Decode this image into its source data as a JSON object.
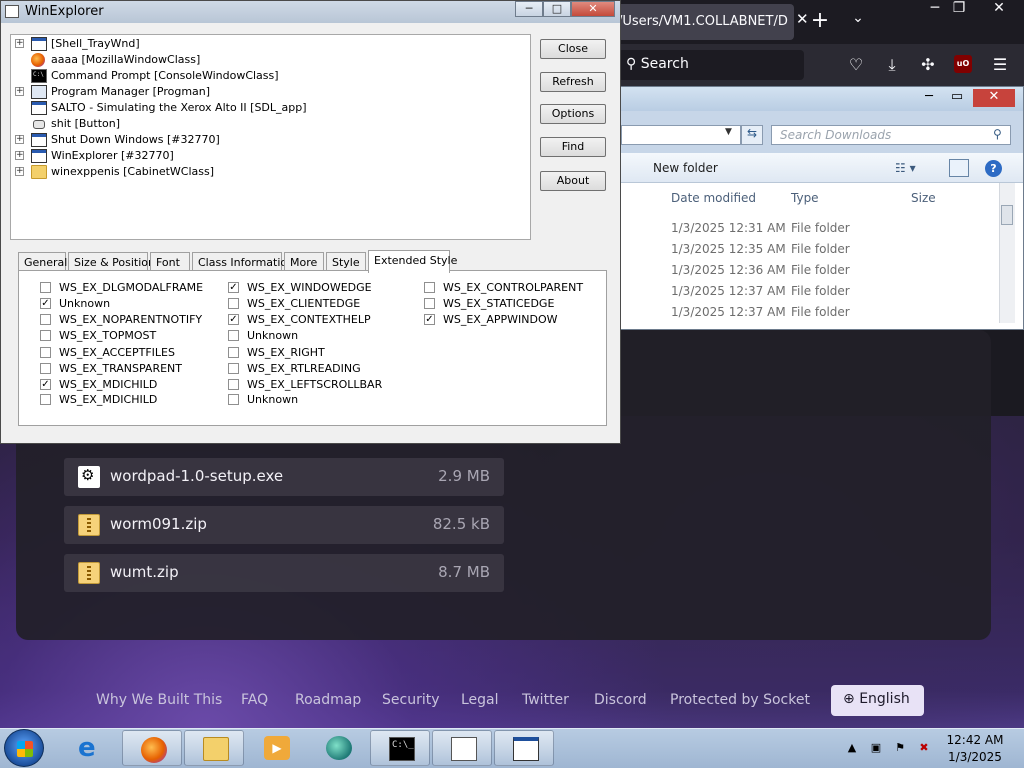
{
  "firefox": {
    "tab_title": "/Users/VM1.COLLABNET/D",
    "tab_close": "✕",
    "new_tab": "+",
    "tab_list": "❯",
    "search_placeholder": "Search",
    "ublock": "uO",
    "win_min": "─",
    "win_max": "❐",
    "win_close": "✕"
  },
  "downloads": {
    "items": [
      {
        "name": "wordpad-1.0-setup.exe",
        "size": "2.9 MB",
        "icon": "exe-icon"
      },
      {
        "name": "worm091.zip",
        "size": "82.5 kB",
        "icon": "zip-icon"
      },
      {
        "name": "wumt.zip",
        "size": "8.7 MB",
        "icon": "zip-icon"
      }
    ]
  },
  "footer": {
    "links": [
      "Why We Built This",
      "FAQ",
      "Roadmap",
      "Security",
      "Legal",
      "Twitter",
      "Discord",
      "Protected by Socket"
    ],
    "language": "English"
  },
  "explorer": {
    "search_placeholder": "Search Downloads",
    "new_folder": "New folder",
    "columns": {
      "date": "Date modified",
      "type": "Type",
      "size": "Size"
    },
    "rows": [
      {
        "date": "1/3/2025 12:31 AM",
        "type": "File folder"
      },
      {
        "date": "1/3/2025 12:35 AM",
        "type": "File folder"
      },
      {
        "date": "1/3/2025 12:36 AM",
        "type": "File folder"
      },
      {
        "date": "1/3/2025 12:37 AM",
        "type": "File folder"
      },
      {
        "date": "1/3/2025 12:37 AM",
        "type": "File folder"
      }
    ]
  },
  "winexplorer": {
    "title": "WinExplorer",
    "tree": [
      {
        "label": "[Shell_TrayWnd]",
        "expander": "+",
        "icon": "win"
      },
      {
        "label": "aaaa [MozillaWindowClass]",
        "expander": "",
        "icon": "ff"
      },
      {
        "label": "Command Prompt [ConsoleWindowClass]",
        "expander": "",
        "icon": "cmd"
      },
      {
        "label": "Program Manager [Progman]",
        "expander": "+",
        "icon": "prog"
      },
      {
        "label": "SALTO - Simulating the Xerox Alto II [SDL_app]",
        "expander": "",
        "icon": "win"
      },
      {
        "label": "shit [Button]",
        "expander": "",
        "icon": "btn"
      },
      {
        "label": "Shut Down Windows [#32770]",
        "expander": "+",
        "icon": "win"
      },
      {
        "label": "WinExplorer [#32770]",
        "expander": "+",
        "icon": "win"
      },
      {
        "label": "winexppenis [CabinetWClass]",
        "expander": "+",
        "icon": "folder"
      }
    ],
    "buttons": {
      "close": "Close",
      "refresh": "Refresh",
      "options": "Options",
      "find": "Find",
      "about": "About"
    },
    "tabs": [
      "General",
      "Size & Position",
      "Font",
      "Class Information",
      "More",
      "Style",
      "Extended Style"
    ],
    "active_tab": "Extended Style",
    "styles_col1": [
      {
        "label": "WS_EX_DLGMODALFRAME",
        "checked": false
      },
      {
        "label": "Unknown",
        "checked": true
      },
      {
        "label": "WS_EX_NOPARENTNOTIFY",
        "checked": false
      },
      {
        "label": "WS_EX_TOPMOST",
        "checked": false
      },
      {
        "label": "WS_EX_ACCEPTFILES",
        "checked": false
      },
      {
        "label": "WS_EX_TRANSPARENT",
        "checked": false
      },
      {
        "label": "WS_EX_MDICHILD",
        "checked": true
      },
      {
        "label": "WS_EX_MDICHILD",
        "checked": false
      }
    ],
    "styles_col2": [
      {
        "label": "WS_EX_WINDOWEDGE",
        "checked": true
      },
      {
        "label": "WS_EX_CLIENTEDGE",
        "checked": false
      },
      {
        "label": "WS_EX_CONTEXTHELP",
        "checked": true
      },
      {
        "label": "Unknown",
        "checked": false
      },
      {
        "label": "WS_EX_RIGHT",
        "checked": false
      },
      {
        "label": "WS_EX_RTLREADING",
        "checked": false
      },
      {
        "label": "WS_EX_LEFTSCROLLBAR",
        "checked": false
      },
      {
        "label": "Unknown",
        "checked": false
      }
    ],
    "styles_col3": [
      {
        "label": "WS_EX_CONTROLPARENT",
        "checked": false
      },
      {
        "label": "WS_EX_STATICEDGE",
        "checked": false
      },
      {
        "label": "WS_EX_APPWINDOW",
        "checked": true
      }
    ]
  },
  "taskbar": {
    "time": "12:42 AM",
    "date": "1/3/2025",
    "apps": [
      "ie-icon",
      "firefox-icon",
      "explorer-icon",
      "media-player-icon",
      "app-icon",
      "cmd-icon",
      "notepad-icon",
      "window-icon"
    ]
  }
}
